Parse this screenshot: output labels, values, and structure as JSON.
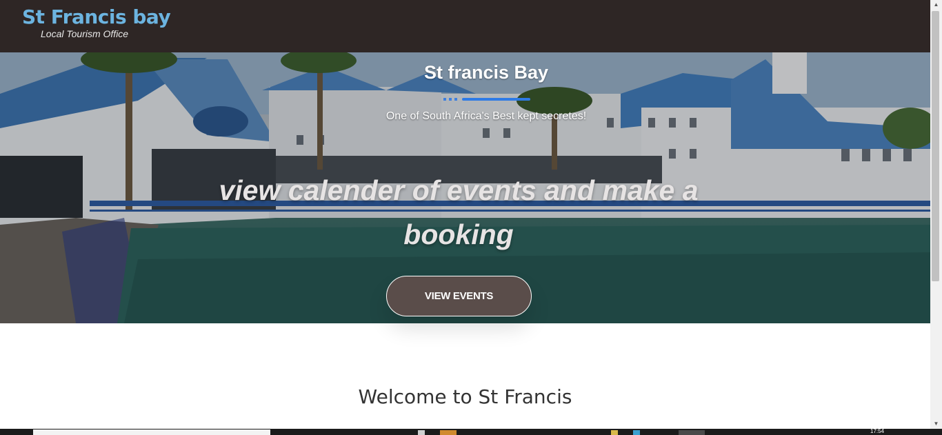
{
  "header": {
    "brand_title": "St Francis bay",
    "brand_subtitle": "Local Tourism Office"
  },
  "hero": {
    "title": "St francis Bay",
    "subtitle": "One of South Africa's Best kept secretes!",
    "heading": "view calender of events and make a booking",
    "cta_label": "VIEW EVENTS"
  },
  "main": {
    "welcome_title": "Welcome to St Francis"
  },
  "taskbar": {
    "clock": "17:54"
  },
  "colors": {
    "header_bg": "#2e2625",
    "brand": "#6cb4e0",
    "divider": "#2e7be6",
    "button_bg": "#5a4d4a"
  }
}
